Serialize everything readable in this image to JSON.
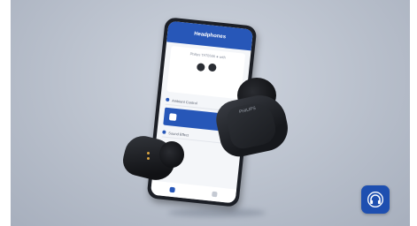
{
  "app": {
    "header_title": "Headphones",
    "device_name": "Philips TAT8506 ● with",
    "section_noise": "Ambient Control",
    "section_sound": "Sound Effect",
    "brand_mark": "PHILIPS"
  },
  "icons": {
    "app_icon": "headphones-icon"
  },
  "colors": {
    "accent": "#2757b8",
    "app_icon_bg": "#1e4fb0",
    "background": "#bcc3ce"
  }
}
